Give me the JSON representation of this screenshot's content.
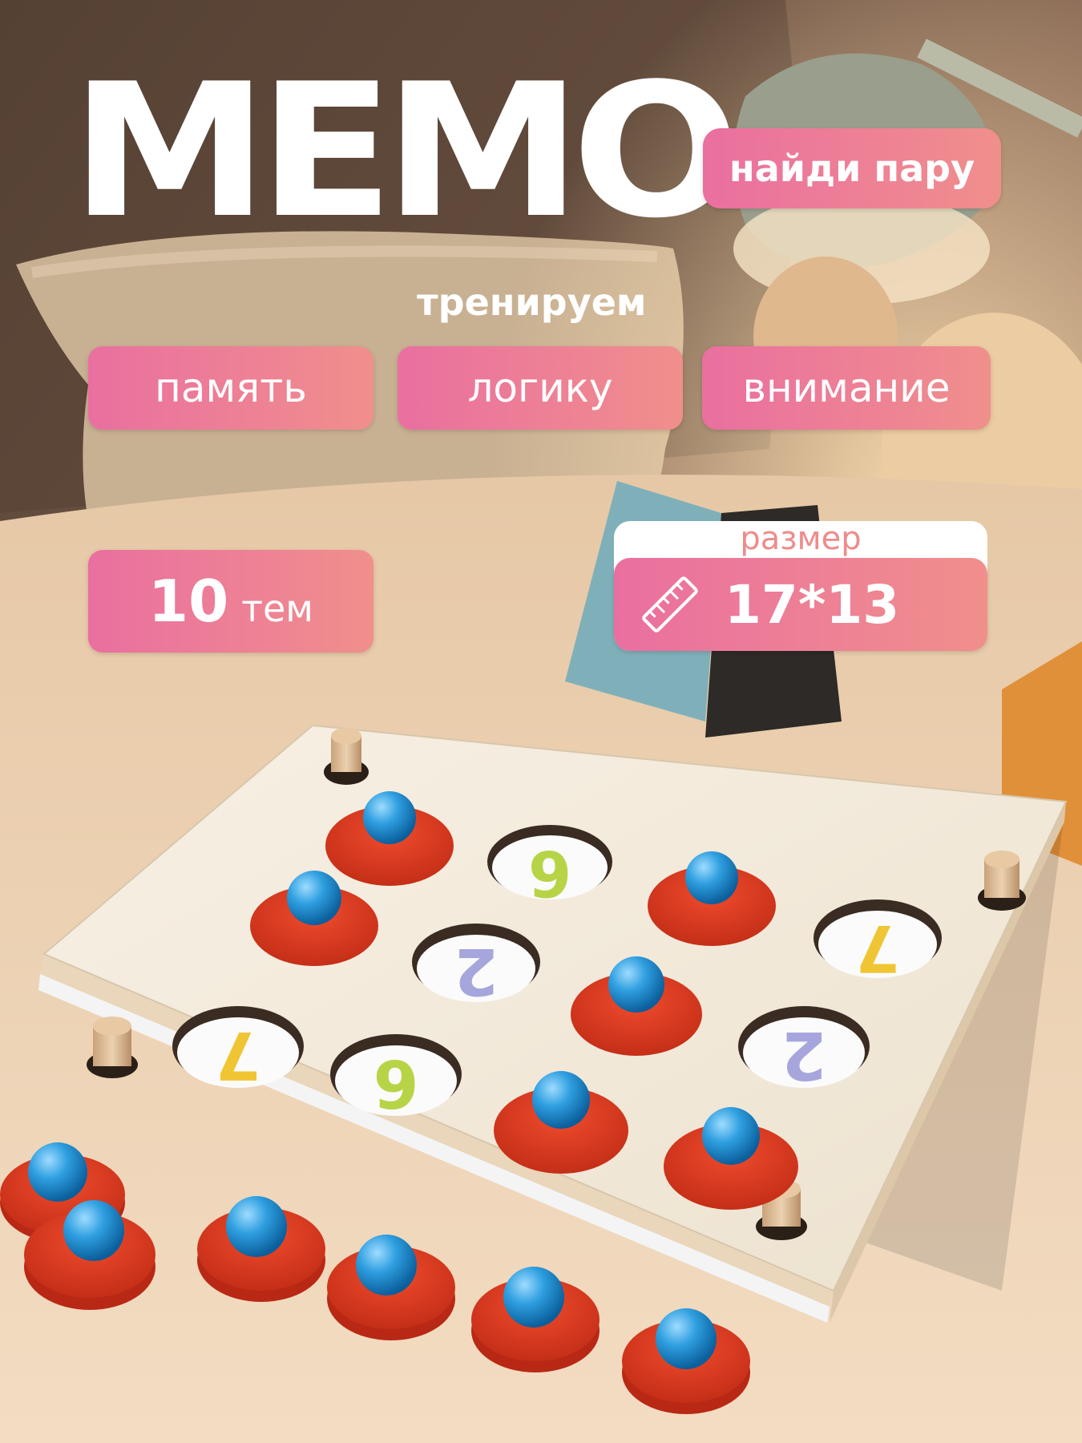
{
  "title": "МЕМО",
  "subtitle_badge": "найди пару",
  "tagline": "тренируем",
  "skills": [
    "память",
    "логику",
    "внимание"
  ],
  "themes": {
    "number": "10",
    "unit": "тем"
  },
  "size": {
    "label": "размер",
    "value": "17*13",
    "icon": "ruler-icon"
  },
  "colors": {
    "pill_start": "#ea6fa0",
    "pill_end": "#f08f8c",
    "disc": "#d8361f",
    "ball": "#2f9fe0"
  }
}
